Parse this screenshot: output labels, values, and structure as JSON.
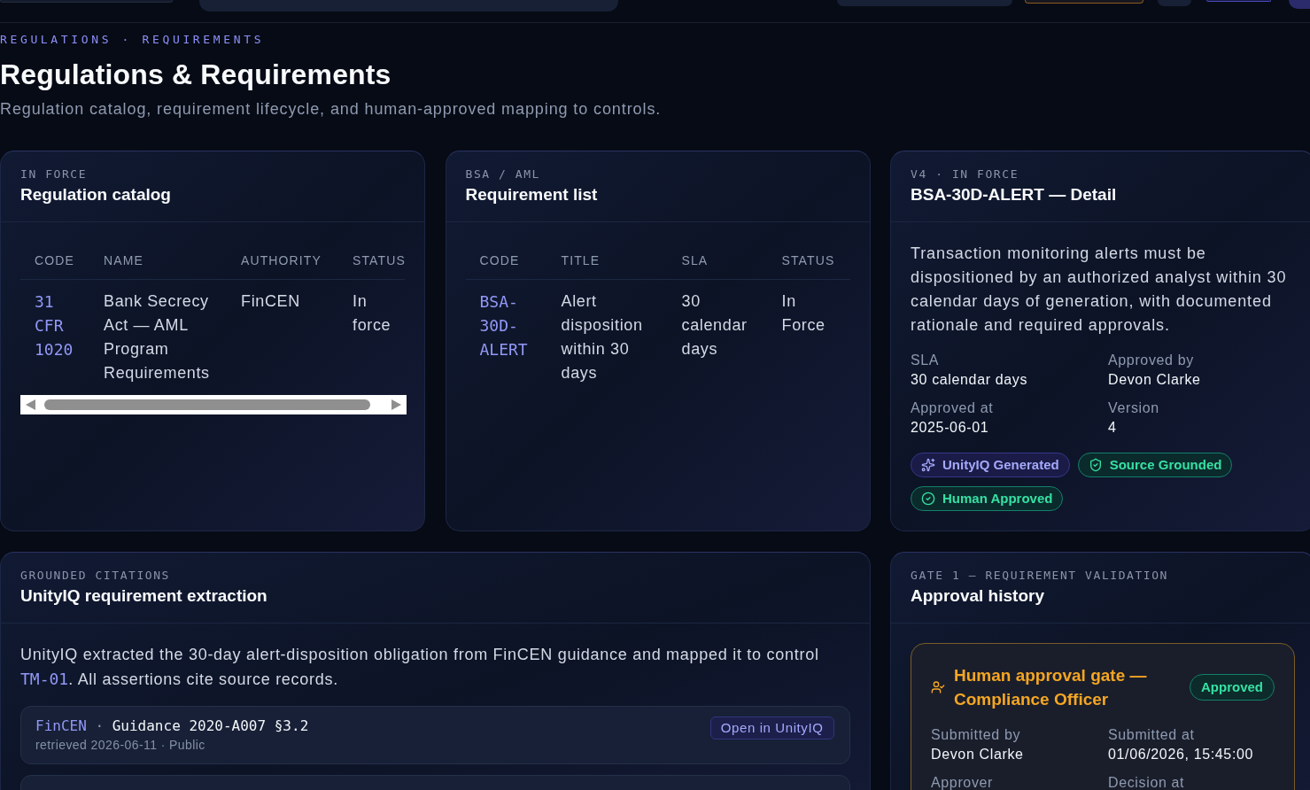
{
  "breadcrumb": "REGULATIONS · REQUIREMENTS",
  "page": {
    "title": "Regulations & Requirements",
    "subtitle": "Regulation catalog, requirement lifecycle, and human-approved mapping to controls."
  },
  "regulation_catalog": {
    "eyebrow": "IN FORCE",
    "title": "Regulation catalog",
    "columns": [
      {
        "label": "CODE",
        "kind": "code"
      },
      {
        "label": "NAME",
        "kind": "text"
      },
      {
        "label": "AUTHORITY",
        "kind": "text"
      },
      {
        "label": "STATUS",
        "kind": "text"
      }
    ],
    "rows": [
      {
        "cells": [
          "31 CFR 1020",
          "Bank Secrecy Act — AML Program Requirements",
          "FinCEN",
          "In force"
        ]
      }
    ]
  },
  "requirement_list": {
    "eyebrow": "BSA / AML",
    "title": "Requirement list",
    "columns": [
      {
        "label": "CODE",
        "kind": "code"
      },
      {
        "label": "TITLE",
        "kind": "text"
      },
      {
        "label": "SLA",
        "kind": "text"
      },
      {
        "label": "STATUS",
        "kind": "text"
      }
    ],
    "rows": [
      {
        "cells": [
          "BSA-30D-ALERT",
          "Alert disposition within 30 days",
          "30 calendar days",
          "In Force"
        ]
      }
    ]
  },
  "requirement_detail": {
    "eyebrow": "V4 · IN FORCE",
    "title": "BSA-30D-ALERT — Detail",
    "description": "Transaction monitoring alerts must be dispositioned by an authorized analyst within 30 calendar days of generation, with documented rationale and required approvals.",
    "fields": [
      {
        "label": "SLA",
        "value": "30 calendar days"
      },
      {
        "label": "Approved by",
        "value": "Devon Clarke"
      },
      {
        "label": "Approved at",
        "value": "2025-06-01"
      },
      {
        "label": "Version",
        "value": "4"
      }
    ],
    "badges": [
      {
        "kind": "generated",
        "label": "UnityIQ Generated"
      },
      {
        "kind": "grounded",
        "label": "Source Grounded"
      },
      {
        "kind": "approved",
        "label": "Human Approved"
      }
    ]
  },
  "extraction": {
    "eyebrow": "GROUNDED CITATIONS",
    "title": "UnityIQ requirement extraction",
    "summary": [
      {
        "kind": "plain",
        "text": "UnityIQ extracted the 30-day alert-disposition obligation from FinCEN guidance and mapped it to control "
      },
      {
        "kind": "code",
        "text": "TM-01"
      },
      {
        "kind": "plain",
        "text": ". All assertions cite source records."
      }
    ],
    "citations": [
      {
        "source": "FinCEN",
        "separator": "·",
        "reference": "Guidance 2020-A007 §3.2",
        "meta": "retrieved 2026-06-11 · Public",
        "action": "Open in UnityIQ"
      }
    ]
  },
  "approval_history": {
    "eyebrow": "GATE 1 — REQUIREMENT VALIDATION",
    "title": "Approval history",
    "gates": [
      {
        "title": "Human approval gate — Compliance Officer",
        "status": {
          "kind": "approved",
          "label": "Approved"
        },
        "fields": [
          {
            "label": "Submitted by",
            "value": "Devon Clarke"
          },
          {
            "label": "Submitted at",
            "value": "01/06/2026, 15:45:00"
          },
          {
            "label": "Approver"
          },
          {
            "label": "Decision at"
          }
        ]
      }
    ]
  }
}
